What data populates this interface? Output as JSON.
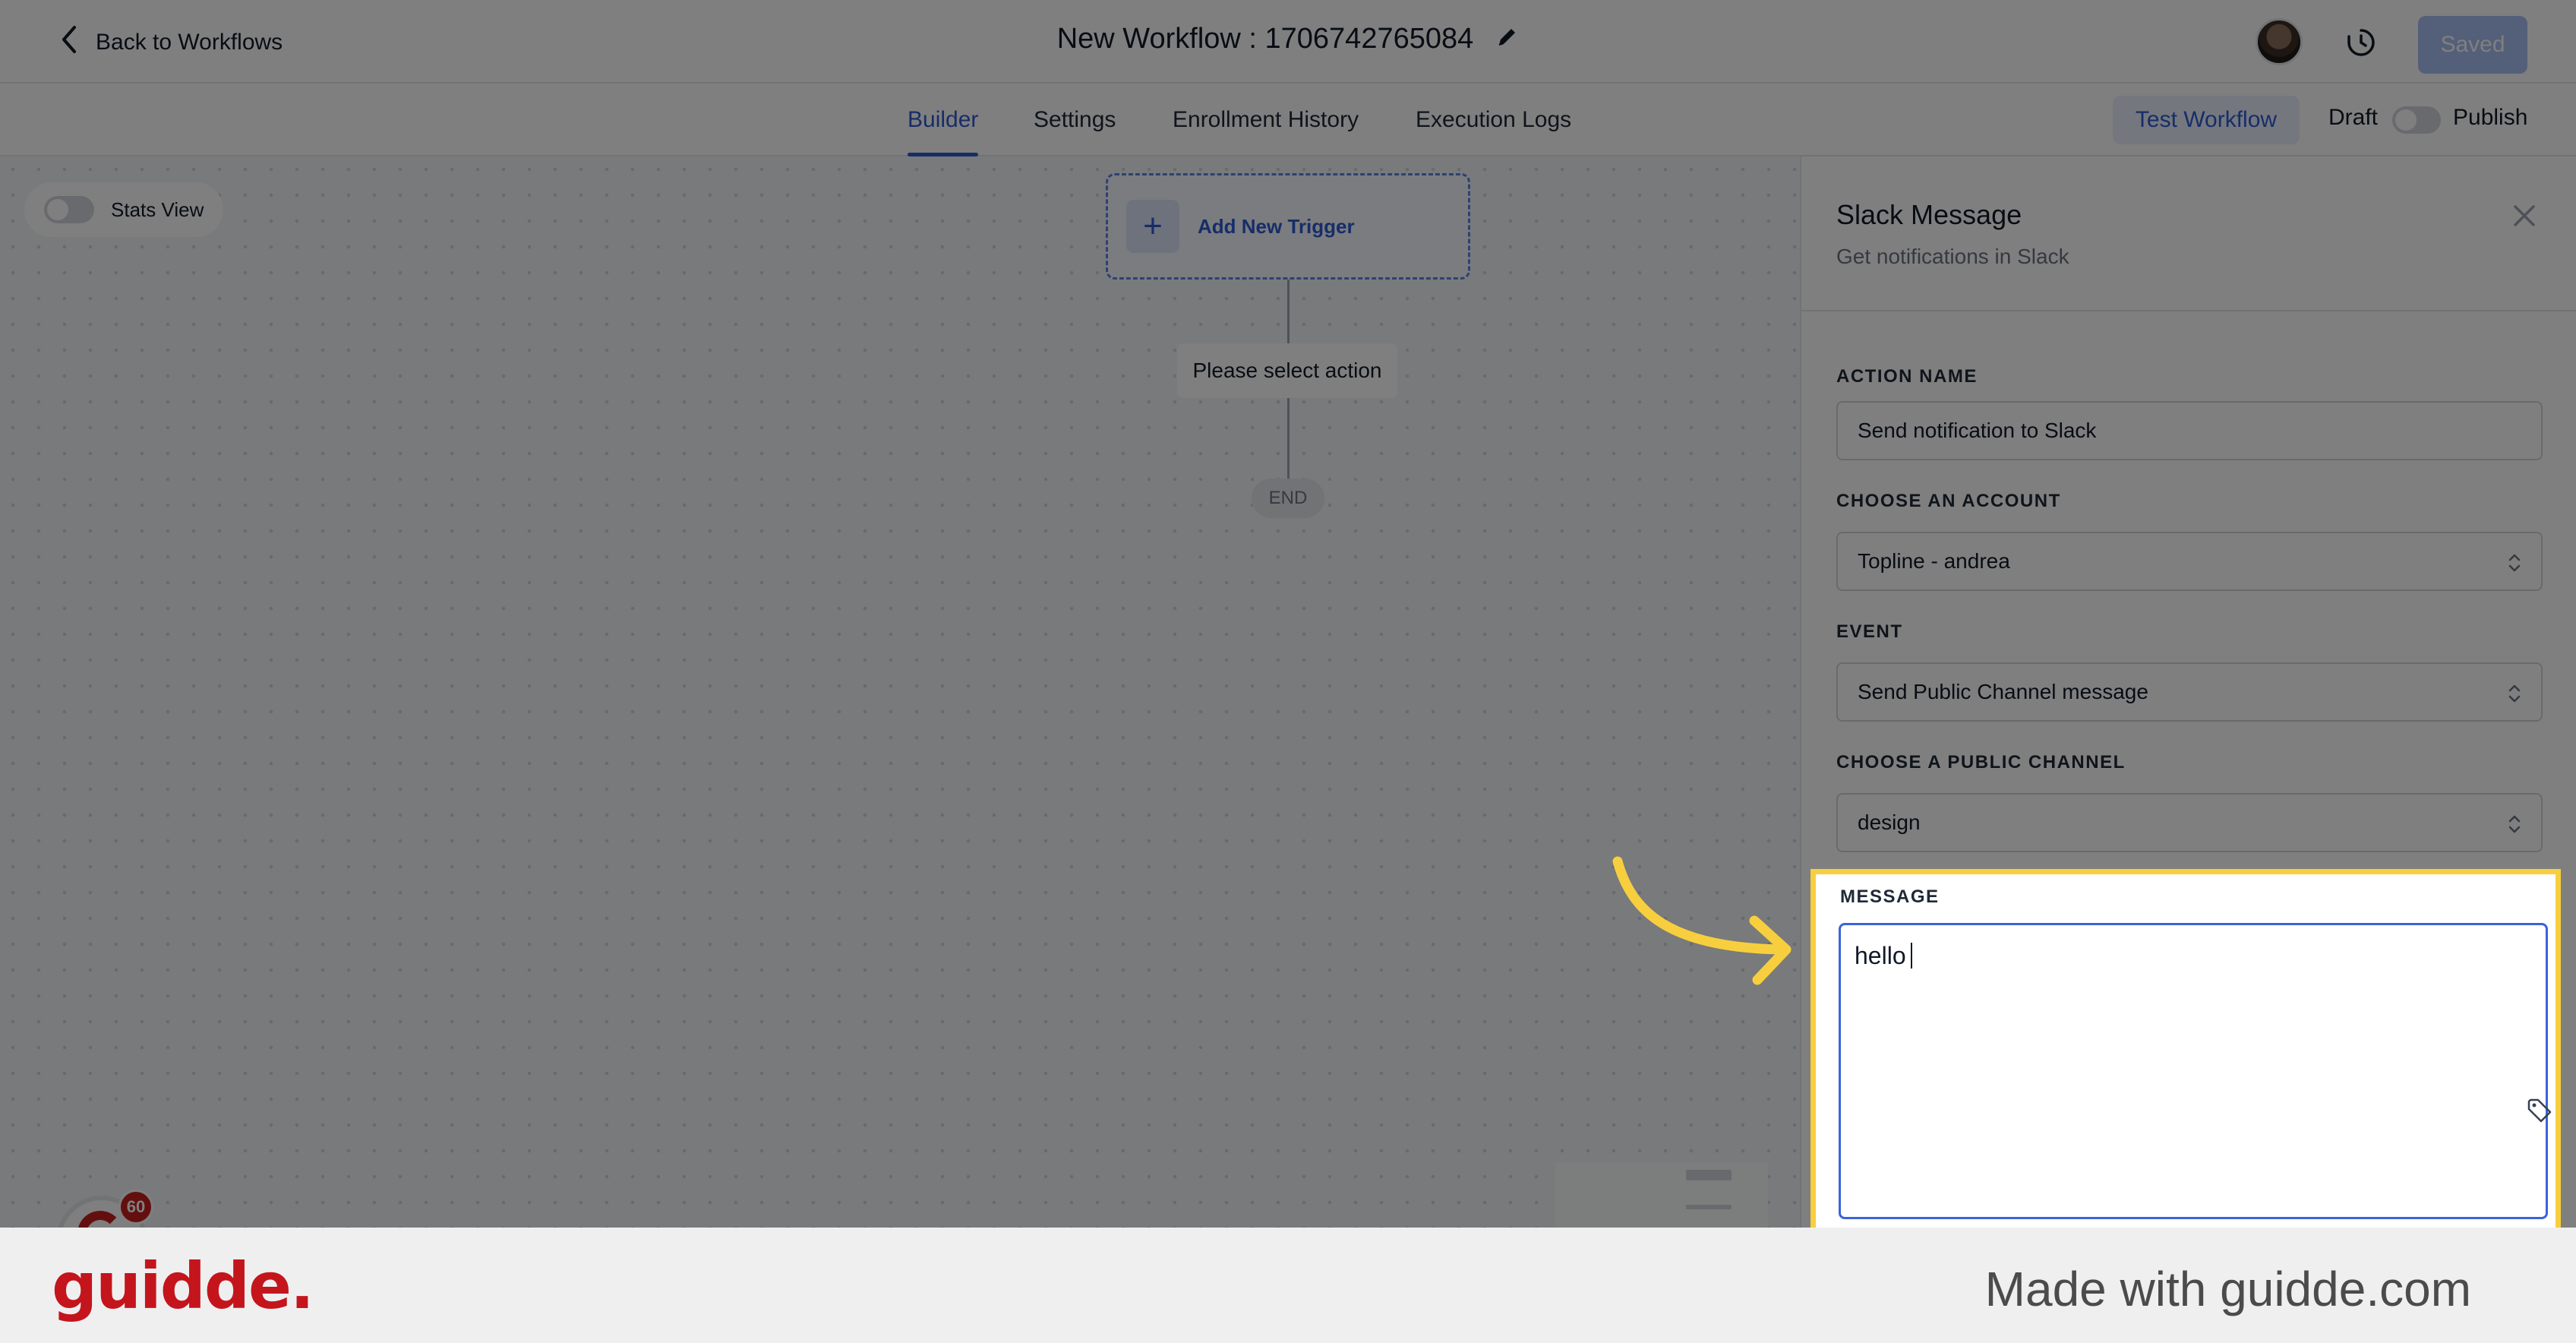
{
  "header": {
    "back_label": "Back to Workflows",
    "workflow_title": "New Workflow : 1706742765084",
    "saved_label": "Saved"
  },
  "tabs": [
    {
      "label": "Builder",
      "active": true
    },
    {
      "label": "Settings",
      "active": false
    },
    {
      "label": "Enrollment History",
      "active": false
    },
    {
      "label": "Execution Logs",
      "active": false
    }
  ],
  "toolbar": {
    "test_workflow_label": "Test Workflow",
    "draft_label": "Draft",
    "publish_label": "Publish",
    "publish_on": false
  },
  "canvas": {
    "stats_view_label": "Stats View",
    "stats_view_on": false,
    "trigger_label": "Add New Trigger",
    "trigger_plus": "+",
    "action_label": "Please select action",
    "end_label": "END",
    "chat_badge_count": "60"
  },
  "panel": {
    "title": "Slack Message",
    "subtitle": "Get notifications in Slack",
    "fields": {
      "action_name": {
        "label": "ACTION NAME",
        "value": "Send notification to Slack"
      },
      "account": {
        "label": "CHOOSE AN ACCOUNT",
        "value": "Topline - andrea"
      },
      "event": {
        "label": "EVENT",
        "value": "Send Public Channel message"
      },
      "channel": {
        "label": "CHOOSE A PUBLIC CHANNEL",
        "value": "design"
      },
      "message": {
        "label": "MESSAGE",
        "value": "hello"
      }
    }
  },
  "footer": {
    "brand": "guidde.",
    "made_with": "Made with guidde.com"
  },
  "colors": {
    "accent": "#2f5bd3",
    "highlight": "#f7cf3e",
    "brand_red": "#c4151c"
  },
  "icons": [
    "chevron-left-icon",
    "edit-pencil-icon",
    "history-icon",
    "plus-icon",
    "close-icon",
    "select-chevron-icon",
    "tag-icon",
    "arrow-annotation-icon"
  ]
}
